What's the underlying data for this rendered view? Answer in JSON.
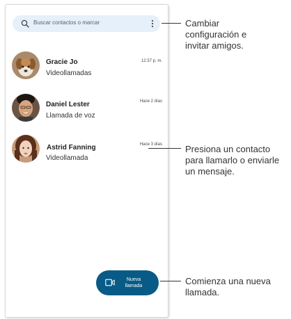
{
  "search": {
    "placeholder": "Buscar contactos o marcar"
  },
  "contacts": [
    {
      "name": "Gracie Jo",
      "sub": "Videollamadas",
      "time": "12:37 p. m."
    },
    {
      "name": "Daniel Lester",
      "sub": "Llamada de voz",
      "time": "Hace 2 días"
    },
    {
      "name": "Astrid Fanning",
      "sub": "Videollamada",
      "time": "Hace 3 días"
    }
  ],
  "fab": {
    "label": "Nueva llamada"
  },
  "callouts": {
    "settings": [
      "Cambiar",
      "configuración e",
      "invitar amigos."
    ],
    "contact": [
      "Presiona un contacto",
      "para llamarlo o enviarle",
      "un mensaje."
    ],
    "new_call": [
      "Comienza una nueva",
      "llamada."
    ]
  },
  "colors": {
    "fab": "#085b86",
    "search_bg": "#e6f0fa"
  }
}
